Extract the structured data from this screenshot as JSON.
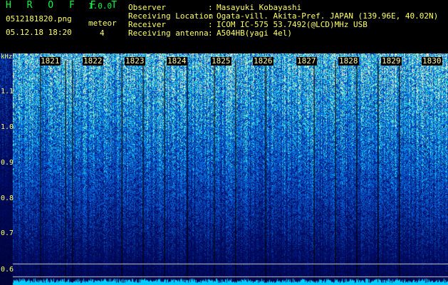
{
  "header": {
    "app_title": "H R O F F T",
    "app_version": "1.0.0",
    "file_name": "0512181820.png",
    "timestamp": "05.12.18 18:20",
    "meteor_label": "meteor",
    "meteor_count": "4"
  },
  "info": [
    {
      "label": "Observer",
      "value": "Masayuki Kobayashi"
    },
    {
      "label": "Receiving Location",
      "value": "Ogata-vill. Akita-Pref. JAPAN (139.96E, 40.02N)"
    },
    {
      "label": "Receiver",
      "value": "ICOM IC-575 53.7492(@LCD)MHz USB"
    },
    {
      "label": "Receiving antenna",
      "value": "A504HB(yagi 4el)"
    }
  ],
  "spectrogram": {
    "unit": "kHz",
    "y_ticks": [
      "1.1",
      "1.0",
      "0.9",
      "0.8",
      "0.7",
      "0.6"
    ],
    "minute_labels": [
      "1821",
      "1822",
      "1823",
      "1824",
      "1825",
      "1826",
      "1827",
      "1828",
      "1829",
      "1830"
    ],
    "colors": {
      "low": "#000033",
      "mid": "#0044cc",
      "high": "#44ffcc",
      "reference_line": "#cccccc",
      "bottom_band": "#00ccff"
    }
  }
}
